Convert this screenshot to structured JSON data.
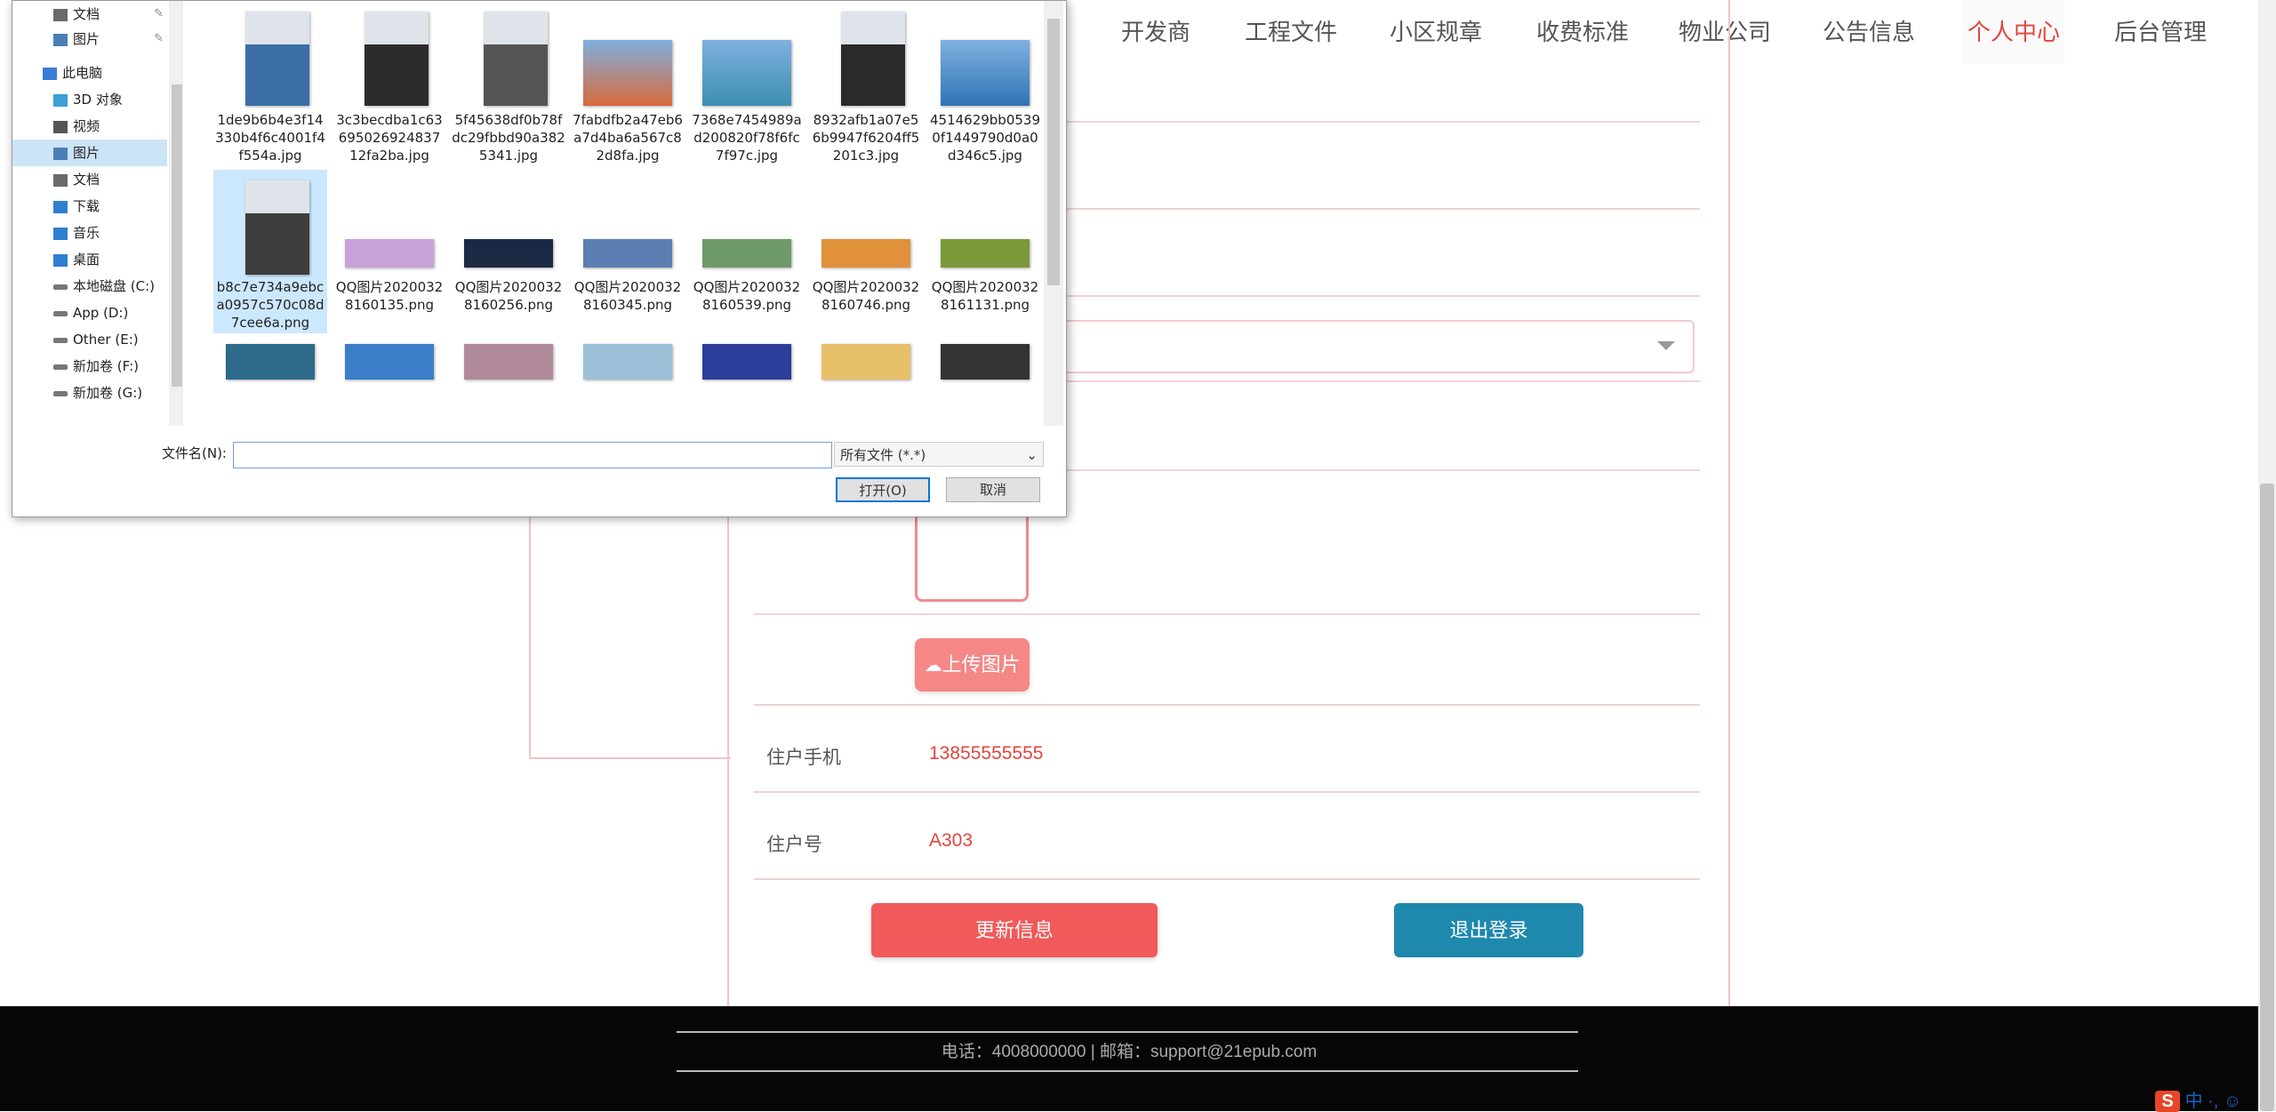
{
  "nav": {
    "items": [
      {
        "label": "开发商"
      },
      {
        "label": "工程文件"
      },
      {
        "label": "小区规章"
      },
      {
        "label": "收费标准"
      },
      {
        "label": "物业公司"
      },
      {
        "label": "公告信息"
      },
      {
        "label": "个人中心",
        "active": true
      },
      {
        "label": "后台管理"
      }
    ]
  },
  "profile": {
    "upload_label": "上传图片",
    "phone_label": "住户手机",
    "phone_value": "13855555555",
    "room_label": "住户号",
    "room_value": "A303",
    "update_label": "更新信息",
    "logout_label": "退出登录"
  },
  "footer": {
    "text": "电话：4008000000 | 邮箱：support@21epub.com"
  },
  "ime": {
    "text": "中 ·, ☺"
  },
  "dialog": {
    "tree": [
      {
        "label": "文档",
        "icon": "documents-icon",
        "pinned": true
      },
      {
        "label": "图片",
        "icon": "pictures-icon",
        "pinned": true
      },
      {
        "label": "此电脑",
        "icon": "this-pc-icon"
      },
      {
        "label": "3D 对象",
        "icon": "3d-objects-icon"
      },
      {
        "label": "视频",
        "icon": "videos-icon"
      },
      {
        "label": "图片",
        "icon": "pictures-icon",
        "selected": true
      },
      {
        "label": "文档",
        "icon": "documents-icon"
      },
      {
        "label": "下载",
        "icon": "downloads-icon"
      },
      {
        "label": "音乐",
        "icon": "music-icon"
      },
      {
        "label": "桌面",
        "icon": "desktop-icon"
      },
      {
        "label": "本地磁盘 (C:)",
        "icon": "drive-icon"
      },
      {
        "label": "App (D:)",
        "icon": "drive-icon"
      },
      {
        "label": "Other (E:)",
        "icon": "drive-icon"
      },
      {
        "label": "新加卷 (F:)",
        "icon": "drive-icon"
      },
      {
        "label": "新加卷 (G:)",
        "icon": "drive-icon"
      }
    ],
    "files": [
      {
        "name": "1de9b6b4e3f14330b4f6c4001f4f554a.jpg",
        "color": "#3a6ea5"
      },
      {
        "name": "3c3becdba1c63695026924837 12fa2ba.jpg",
        "color": "#2b2b2b"
      },
      {
        "name": "5f45638df0b78fdc29fbbd90a3825341.jpg",
        "color": "#555555"
      },
      {
        "name": "7fabdfb2a47eb6a7d4ba6a567c82d8fa.jpg",
        "color": "#d96a3b"
      },
      {
        "name": "7368e7454989ad200820f78f6fc7f97c.jpg",
        "color": "#3c8fb0"
      },
      {
        "name": "8932afb1a07e56b9947f6204ff5201c3.jpg",
        "color": "#2a2a2a"
      },
      {
        "name": "4514629bb05390f1449790d0a0d346c5.jpg",
        "color": "#2f74b5"
      },
      {
        "name": "b8c7e734a9ebca0957c570c08d7cee6a.png",
        "color": "#3d3d3d",
        "selected": true
      },
      {
        "name": "QQ图片20200328160135.png",
        "color": "#c8a2d8"
      },
      {
        "name": "QQ图片20200328160256.png",
        "color": "#1b2a44"
      },
      {
        "name": "QQ图片20200328160345.png",
        "color": "#5b7fb3"
      },
      {
        "name": "QQ图片20200328160539.png",
        "color": "#6e9a6a"
      },
      {
        "name": "QQ图片20200328160746.png",
        "color": "#e0913a"
      },
      {
        "name": "QQ图片20200328161131.png",
        "color": "#7a9a3a"
      },
      {
        "name": "",
        "color": "#2e6a8a"
      },
      {
        "name": "",
        "color": "#3b7ec8"
      },
      {
        "name": "",
        "color": "#b08a9a"
      },
      {
        "name": "",
        "color": "#9cc0d8"
      },
      {
        "name": "",
        "color": "#2c3e9a"
      },
      {
        "name": "",
        "color": "#e8c06a"
      },
      {
        "name": "",
        "color": "#333333"
      }
    ],
    "filename_label": "文件名(N):",
    "filename_value": "",
    "filter_value": "所有文件 (*.*)",
    "open_label": "打开(O)",
    "cancel_label": "取消"
  }
}
